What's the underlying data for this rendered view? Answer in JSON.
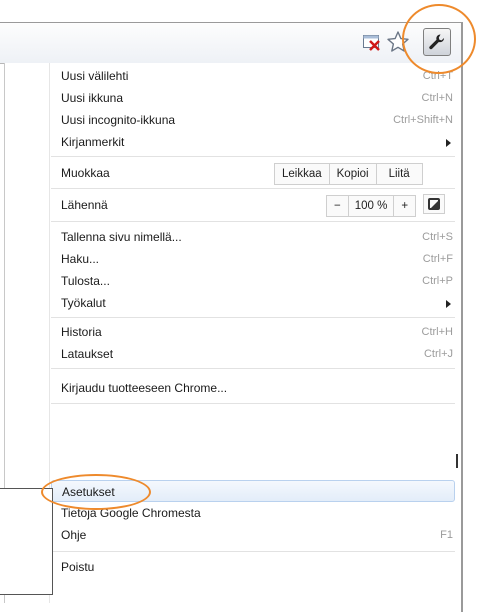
{
  "toolbar": {
    "page_action_icon": "page-blocked-icon",
    "bookmark_icon": "star-icon",
    "menu_icon": "wrench-icon"
  },
  "menu": {
    "items": [
      {
        "label": "Uusi välilehti",
        "shortcut": "Ctrl+T"
      },
      {
        "label": "Uusi ikkuna",
        "shortcut": "Ctrl+N"
      },
      {
        "label": "Uusi incognito-ikkuna",
        "shortcut": "Ctrl+Shift+N"
      },
      {
        "label": "Kirjanmerkit",
        "shortcut": ""
      },
      {
        "label": "Muokkaa",
        "shortcut": ""
      },
      {
        "label": "Lähennä",
        "shortcut": ""
      },
      {
        "label": "Tallenna sivu nimellä...",
        "shortcut": "Ctrl+S"
      },
      {
        "label": "Haku...",
        "shortcut": "Ctrl+F"
      },
      {
        "label": "Tulosta...",
        "shortcut": "Ctrl+P"
      },
      {
        "label": "Työkalut",
        "shortcut": ""
      },
      {
        "label": "Historia",
        "shortcut": "Ctrl+H"
      },
      {
        "label": "Lataukset",
        "shortcut": "Ctrl+J"
      },
      {
        "label": "Kirjaudu tuotteeseen Chrome...",
        "shortcut": ""
      },
      {
        "label": "Asetukset",
        "shortcut": ""
      },
      {
        "label": "Tietoja Google Chromesta",
        "shortcut": ""
      },
      {
        "label": "Ohje",
        "shortcut": "F1"
      },
      {
        "label": "Poistu",
        "shortcut": ""
      }
    ],
    "edit": {
      "cut": "Leikkaa",
      "copy": "Kopioi",
      "paste": "Liitä"
    },
    "zoom": {
      "minus": "−",
      "value": "100 %",
      "plus": "+"
    }
  },
  "colors": {
    "callout": "#ee8a2c",
    "highlight": "#e3edf9",
    "shortcut_text": "#9c9c9c"
  }
}
